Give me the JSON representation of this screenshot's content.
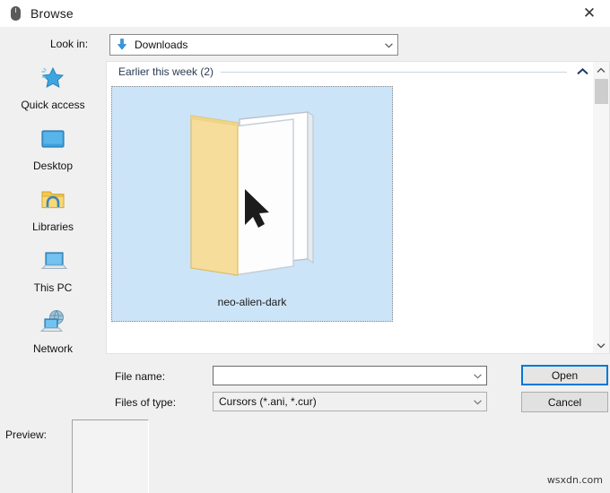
{
  "window": {
    "title": "Browse",
    "icon": "mouse-icon",
    "close_label": "✕"
  },
  "toolbar": {
    "lookin_label": "Look in:",
    "lookin_value": "Downloads",
    "lookin_icon": "download-arrow-icon",
    "buttons": [
      {
        "name": "back-button",
        "icon": "back-globe-icon"
      },
      {
        "name": "up-one-level-button",
        "icon": "up-folder-icon"
      },
      {
        "name": "new-folder-button",
        "icon": "new-folder-icon"
      },
      {
        "name": "views-button",
        "icon": "views-icon"
      }
    ],
    "views_caret": "▾"
  },
  "sidebar": {
    "items": [
      {
        "label": "Quick access",
        "icon": "star-icon"
      },
      {
        "label": "Desktop",
        "icon": "monitor-icon"
      },
      {
        "label": "Libraries",
        "icon": "libraries-folder-icon"
      },
      {
        "label": "This PC",
        "icon": "laptop-icon"
      },
      {
        "label": "Network",
        "icon": "network-globe-icon"
      }
    ]
  },
  "file_list": {
    "group_header": "Earlier this week (2)",
    "collapse_icon": "chevron-up-icon",
    "items": [
      {
        "name": "neo-alien-dark",
        "icon": "open-folder-cursor-icon",
        "selected": true
      }
    ]
  },
  "scrollbar": {
    "up_icon": "chevron-up-icon",
    "down_icon": "chevron-down-icon"
  },
  "form": {
    "file_name_label": "File name:",
    "file_name_value": "",
    "file_name_placeholder": "",
    "files_of_type_label": "Files of type:",
    "files_of_type_value": "Cursors (*.ani, *.cur)",
    "open_label": "Open",
    "cancel_label": "Cancel"
  },
  "preview": {
    "label": "Preview:"
  },
  "watermark": "wsxdn.com",
  "colors": {
    "accent": "#0078d7",
    "selection": "#cce4f7",
    "dialog_bg": "#f0f0f0",
    "group_title": "#2a3a52"
  }
}
